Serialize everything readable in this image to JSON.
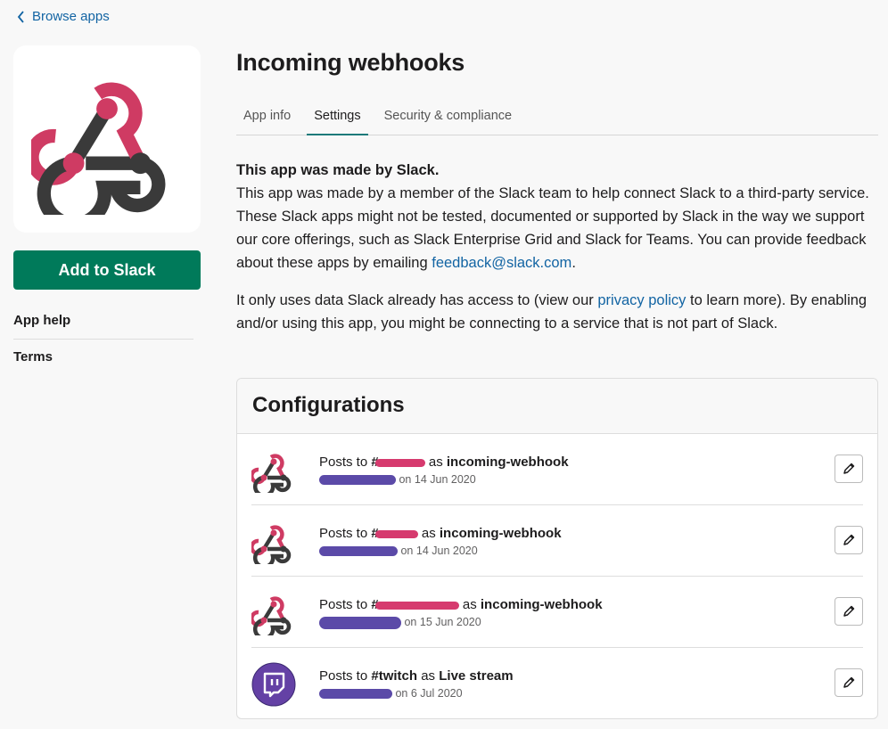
{
  "nav": {
    "back_label": "Browse apps"
  },
  "app": {
    "title": "Incoming webhooks",
    "add_button": "Add to Slack",
    "brand_color": "#007a5a"
  },
  "sidebar": {
    "links": [
      "App help",
      "Terms"
    ]
  },
  "tabs": [
    {
      "label": "App info",
      "active": false
    },
    {
      "label": "Settings",
      "active": true
    },
    {
      "label": "Security & compliance",
      "active": false
    }
  ],
  "about": {
    "heading": "This app was made by Slack.",
    "body": "This app was made by a member of the Slack team to help connect Slack to a third-party service. These Slack apps might not be tested, documented or supported by Slack in the way we support our core offerings, such as Slack Enterprise Grid and Slack for Teams. You can provide feedback about these apps by emailing ",
    "email": "feedback@slack.com",
    "period": ".",
    "data_pre": "It only uses data Slack already has access to (view our ",
    "privacy_link": "privacy policy",
    "data_post": " to learn more). By enabling and/or using this app, you might be connecting to a service that is not part of Slack."
  },
  "configurations": {
    "title": "Configurations",
    "rows": [
      {
        "icon": "webhook-icon",
        "posts_to": "Posts to ",
        "channel": "#",
        "as": " as ",
        "name": "incoming-webhook",
        "date": "on 14 Jun 2020"
      },
      {
        "icon": "webhook-icon",
        "posts_to": "Posts to ",
        "channel": "#",
        "as": " as ",
        "name": "incoming-webhook",
        "date": "on 14 Jun 2020"
      },
      {
        "icon": "webhook-icon",
        "posts_to": "Posts to ",
        "channel": "#",
        "as": " as ",
        "name": "incoming-webhook",
        "date": "on 15 Jun 2020"
      },
      {
        "icon": "twitch-icon",
        "posts_to": "Posts to ",
        "channel": "#twitch",
        "as": " as ",
        "name": "Live stream",
        "date": "on 6 Jul 2020"
      }
    ]
  },
  "colors": {
    "link": "#1264a3",
    "redact_pink": "#d63a6e",
    "redact_purple": "#5b4aa8",
    "twitch": "#6441a5"
  }
}
